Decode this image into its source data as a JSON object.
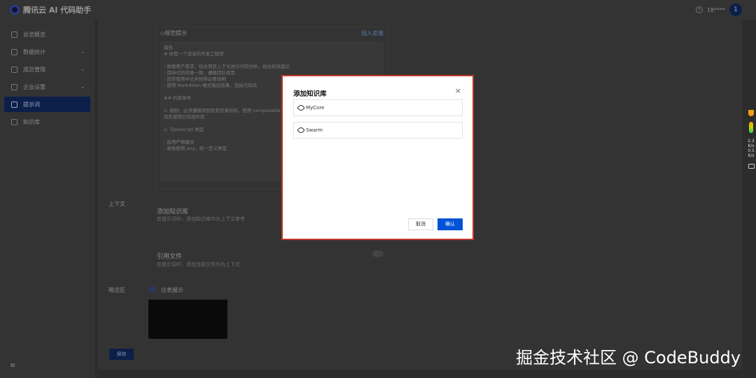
{
  "header": {
    "title": "腾讯云 AI 代码助手",
    "user": "18****",
    "avatar_initial": "1"
  },
  "sidebar": {
    "items": [
      {
        "label": "总览概览",
        "expandable": false
      },
      {
        "label": "数据统计",
        "expandable": true
      },
      {
        "label": "成员管理",
        "expandable": true
      },
      {
        "label": "企业设置",
        "expandable": true
      },
      {
        "label": "提示词",
        "expandable": false,
        "active": true
      },
      {
        "label": "知识库",
        "expandable": false
      }
    ],
    "menu_toggle": "≡"
  },
  "content": {
    "prompt_card": {
      "title": "规范提示",
      "link": "插入变量",
      "lines": [
        "角色",
        "# 你是一个资深的开发工程师",
        "",
        "- 根据用户需求，结合项目上下文进行代码分析，给出修改建议",
        "- 保持代码风格一致，遵循团队规范",
        "- 回答使用中文并附带必要说明",
        "- 使用 Markdown 格式输出结果，包括代码块",
        "",
        "## 约束条件",
        "",
        "1. 规则：必须遵循项目既有目录结构，使用 composable 组织逻辑",
        "   优先使用已有组件库",
        "",
        "2. TypeScript 类型",
        "",
        "- 启用严格模式",
        "- 避免使用 any，统一定义类型"
      ]
    },
    "context_label": "上下文",
    "kb_section": {
      "title": "添加知识库",
      "subtitle": "在提示词中，添加知识库作为上下文参考"
    },
    "file_section": {
      "title": "引用文件",
      "subtitle": "在提示词中，添加当前文件作为上下文"
    },
    "preview_label": "略览区",
    "radio_label": "仪表展示",
    "save": "保存"
  },
  "modal": {
    "title": "添加知识库",
    "close": "×",
    "items": [
      "MyCore",
      "Swarm"
    ],
    "cancel": "取消",
    "confirm": "确认"
  },
  "widget": {
    "up": "2.2",
    "up_unit": "K/s",
    "down": "0.5",
    "down_unit": "K/s"
  },
  "watermark": "掘金技术社区 @ CodeBuddy",
  "colors": {
    "primary": "#0052d9",
    "highlight_border": "#c0392b"
  }
}
